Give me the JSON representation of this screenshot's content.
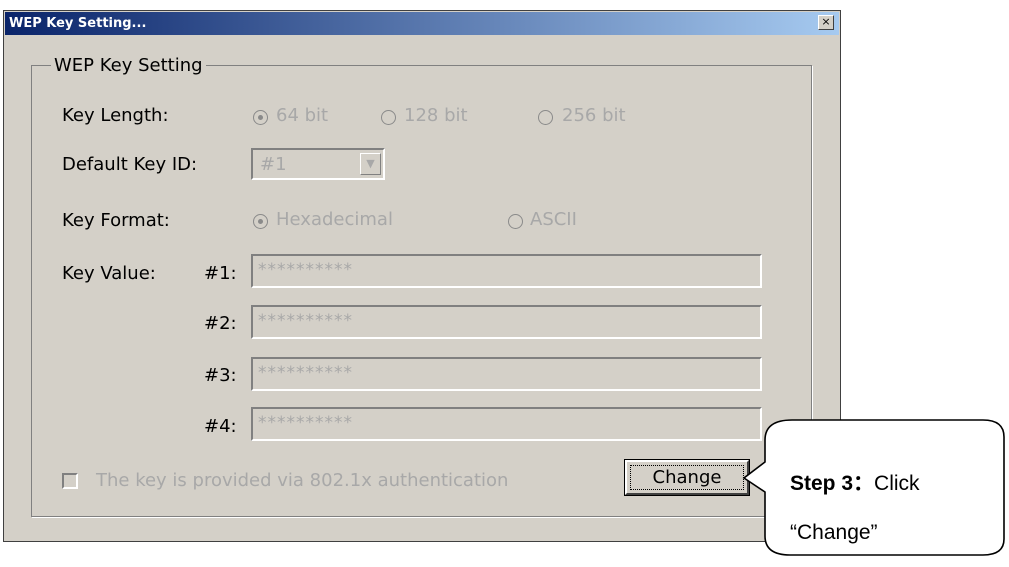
{
  "window": {
    "title": "WEP Key Setting...",
    "close_glyph": "×"
  },
  "group": {
    "title": "WEP Key Setting"
  },
  "key_length": {
    "label": "Key Length:",
    "options": [
      "64 bit",
      "128 bit",
      "256 bit"
    ],
    "selected": "64 bit"
  },
  "default_key_id": {
    "label": "Default Key ID:",
    "value": "#1"
  },
  "key_format": {
    "label": "Key Format:",
    "options": [
      "Hexadecimal",
      "ASCII"
    ],
    "selected": "Hexadecimal"
  },
  "key_value": {
    "label": "Key Value:",
    "keys": [
      {
        "id": "#1:",
        "value": "**********"
      },
      {
        "id": "#2:",
        "value": "**********"
      },
      {
        "id": "#3:",
        "value": "**********"
      },
      {
        "id": "#4:",
        "value": "**********"
      }
    ]
  },
  "auth_checkbox": {
    "label": "The key is provided via 802.1x authentication",
    "checked": false
  },
  "change_button": {
    "label": "Change"
  },
  "callout": {
    "step": "Step 3",
    "separator": "：",
    "action": "Click",
    "line2": "“Change”"
  },
  "colors": {
    "dialog_bg": "#d4d0c8",
    "title_start": "#0a246a",
    "title_end": "#a6caf0",
    "disabled_text": "#a8a8a8"
  }
}
